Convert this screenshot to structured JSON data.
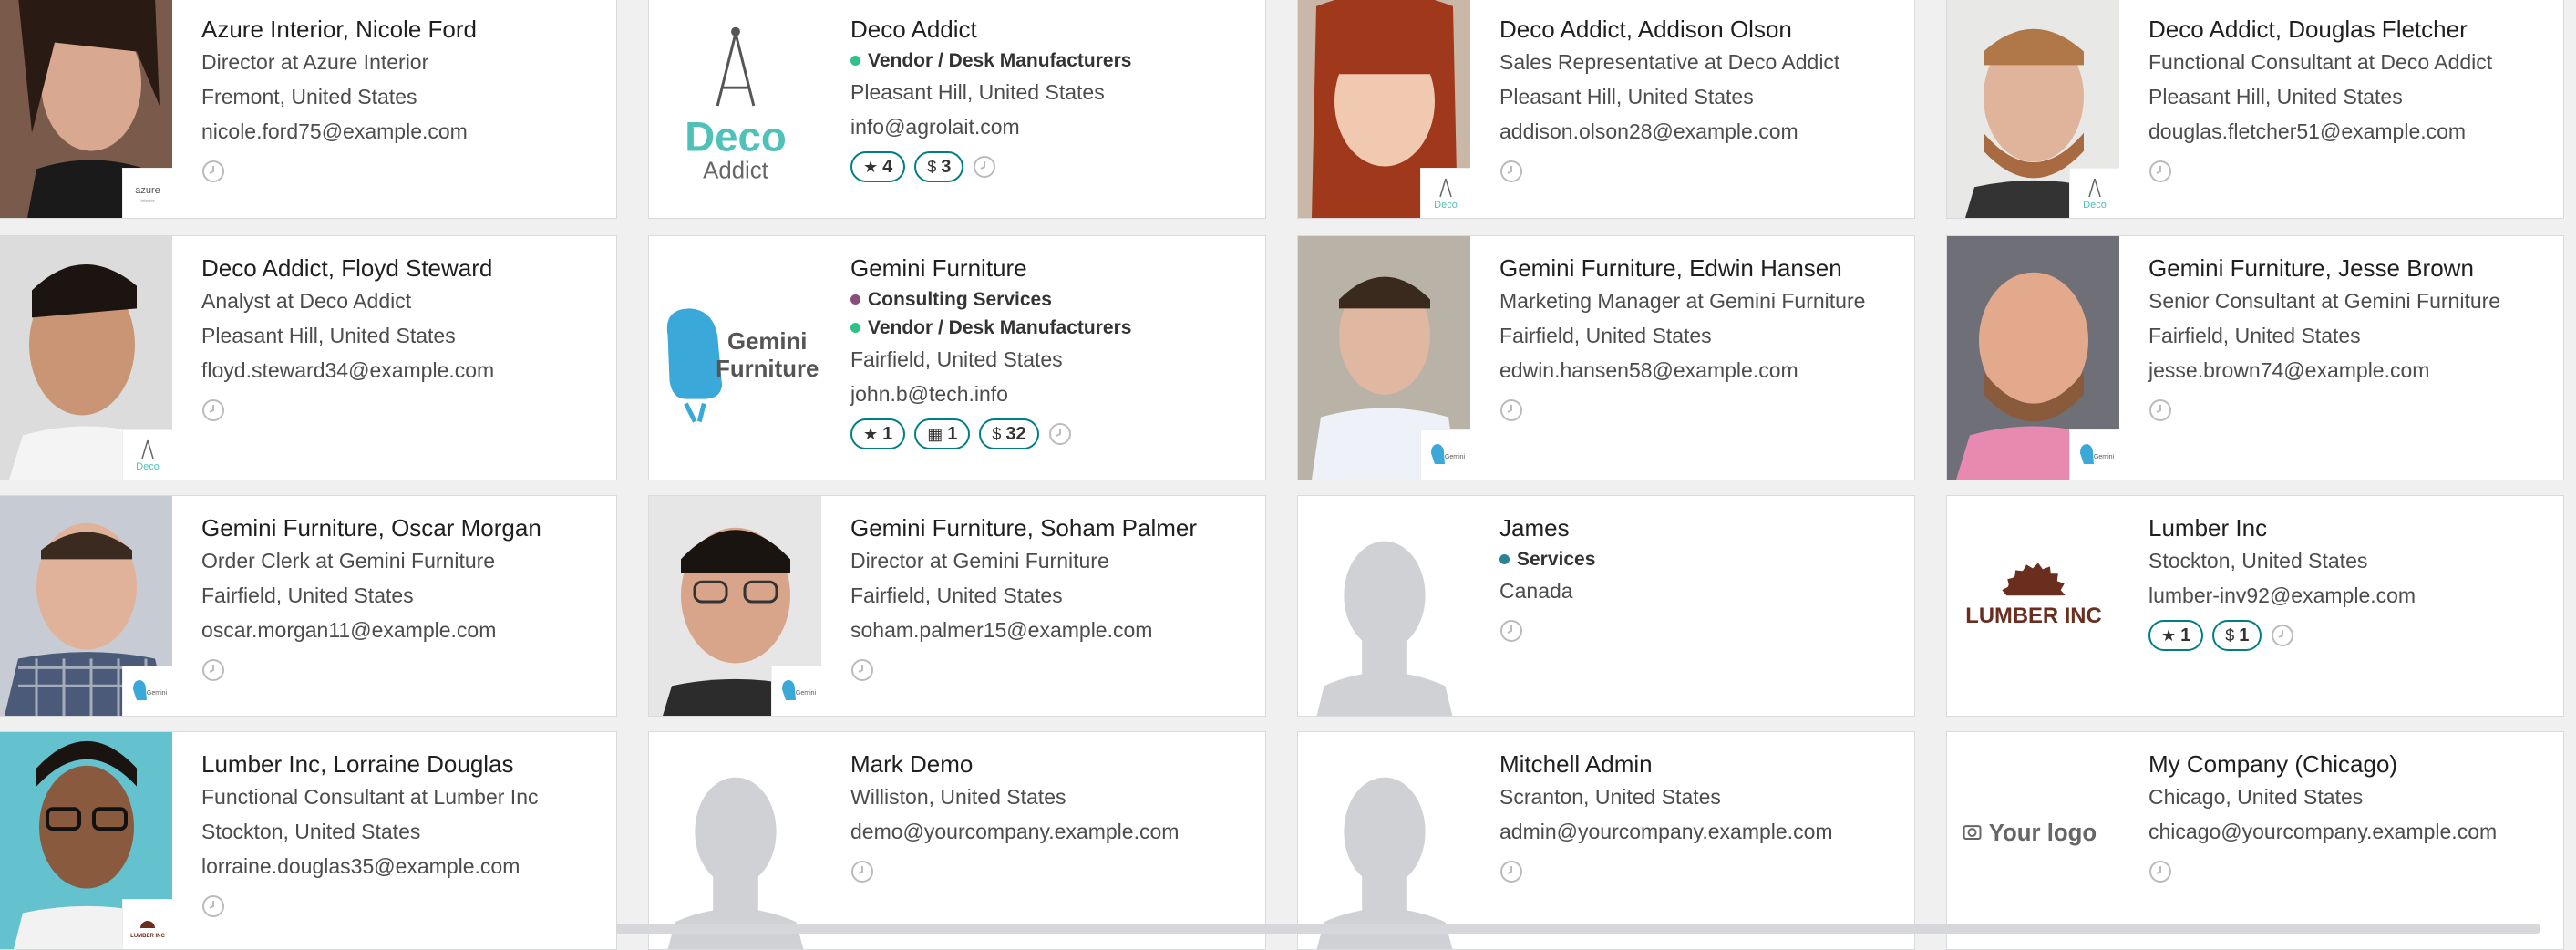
{
  "cards": [
    {
      "title": "Azure Interior, Nicole Ford",
      "lines": [
        "Director at Azure Interior",
        "Fremont, United States",
        "nicole.ford75@example.com"
      ]
    },
    {
      "title": "Deco Addict",
      "tags": [
        {
          "label": "Vendor / Desk Manufacturers",
          "color": "#2ec286"
        }
      ],
      "lines": [
        "Pleasant Hill, United States",
        "info@agrolait.com"
      ],
      "badges": [
        {
          "icon": "★",
          "value": "4"
        },
        {
          "icon": "$",
          "value": "3"
        }
      ],
      "logo": {
        "line1": "Deco",
        "line2": "Addict"
      }
    },
    {
      "title": "Deco Addict, Addison Olson",
      "lines": [
        "Sales Representative at Deco Addict",
        "Pleasant Hill, United States",
        "addison.olson28@example.com"
      ],
      "sublogo": {
        "line1": "Deco",
        "line2": "Addict"
      }
    },
    {
      "title": "Deco Addict, Douglas Fletcher",
      "lines": [
        "Functional Consultant at Deco Addict",
        "Pleasant Hill, United States",
        "douglas.fletcher51@example.com"
      ],
      "sublogo": {
        "line1": "Deco",
        "line2": "Addict"
      }
    },
    {
      "title": "Deco Addict, Floyd Steward",
      "lines": [
        "Analyst at Deco Addict",
        "Pleasant Hill, United States",
        "floyd.steward34@example.com"
      ],
      "sublogo": {
        "line1": "Deco",
        "line2": "Addict"
      }
    },
    {
      "title": "Gemini Furniture",
      "tags": [
        {
          "label": "Consulting Services",
          "color": "#8a4c7d"
        },
        {
          "label": "Vendor / Desk Manufacturers",
          "color": "#2ec286"
        }
      ],
      "lines": [
        "Fairfield, United States",
        "john.b@tech.info"
      ],
      "badges": [
        {
          "icon": "★",
          "value": "1"
        },
        {
          "icon": "▦",
          "value": "1"
        },
        {
          "icon": "$",
          "value": "32"
        }
      ],
      "logo": {
        "line1": "Gemini",
        "line2": "Furniture"
      }
    },
    {
      "title": "Gemini Furniture, Edwin Hansen",
      "lines": [
        "Marketing Manager at Gemini Furniture",
        "Fairfield, United States",
        "edwin.hansen58@example.com"
      ]
    },
    {
      "title": "Gemini Furniture, Jesse Brown",
      "lines": [
        "Senior Consultant at Gemini Furniture",
        "Fairfield, United States",
        "jesse.brown74@example.com"
      ]
    },
    {
      "title": "Gemini Furniture, Oscar Morgan",
      "lines": [
        "Order Clerk at Gemini Furniture",
        "Fairfield, United States",
        "oscar.morgan11@example.com"
      ]
    },
    {
      "title": "Gemini Furniture, Soham Palmer",
      "lines": [
        "Director at Gemini Furniture",
        "Fairfield, United States",
        "soham.palmer15@example.com"
      ]
    },
    {
      "title": "James",
      "tags": [
        {
          "label": "Services",
          "color": "#2c8397"
        }
      ],
      "lines": [
        "Canada"
      ]
    },
    {
      "title": "Lumber Inc",
      "lines": [
        "Stockton, United States",
        "lumber-inv92@example.com"
      ],
      "badges": [
        {
          "icon": "★",
          "value": "1"
        },
        {
          "icon": "$",
          "value": "1"
        }
      ],
      "logo": {
        "line1": "LUMBER INC"
      }
    },
    {
      "title": "Lumber Inc, Lorraine Douglas",
      "lines": [
        "Functional Consultant at Lumber Inc",
        "Stockton, United States",
        "lorraine.douglas35@example.com"
      ]
    },
    {
      "title": "Mark Demo",
      "lines": [
        "Williston, United States",
        "demo@yourcompany.example.com"
      ]
    },
    {
      "title": "Mitchell Admin",
      "lines": [
        "Scranton, United States",
        "admin@yourcompany.example.com"
      ]
    },
    {
      "title": "My Company (Chicago)",
      "lines": [
        "Chicago, United States",
        "chicago@yourcompany.example.com"
      ],
      "logo": {
        "line1": "Your logo"
      }
    }
  ]
}
